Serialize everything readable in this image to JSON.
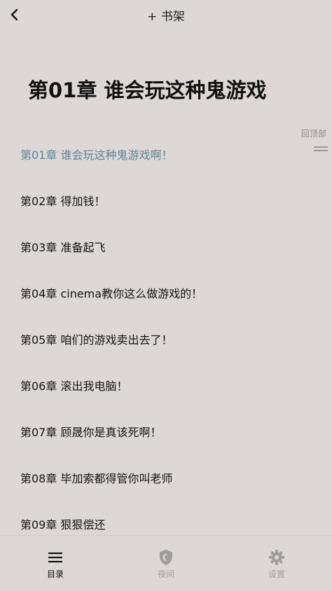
{
  "header": {
    "back_icon": "chevron-left-icon",
    "add_to_shelf": "+ 书架"
  },
  "reader": {
    "chapter_title": "第01章 谁会玩这种鬼游戏啊！",
    "back_to_top": "回顶部"
  },
  "toc": {
    "current_index": 0,
    "items": [
      "第01章 谁会玩这种鬼游戏啊！",
      "第02章 得加钱！",
      "第03章 准备起飞",
      "第04章 cinema教你这么做游戏的！",
      "第05章 咱们的游戏卖出去了！",
      "第06章 滚出我电脑！",
      "第07章 顾晟你是真该死啊！",
      "第08章 毕加索都得管你叫老师",
      "第09章 狠狠偿还"
    ]
  },
  "bottom_nav": {
    "items": [
      {
        "label": "目录",
        "icon": "menu-icon",
        "active": true
      },
      {
        "label": "夜间",
        "icon": "night-shield-icon",
        "active": false
      },
      {
        "label": "设置",
        "icon": "gear-icon",
        "active": false
      }
    ]
  },
  "colors": {
    "background": "#ddd8d5",
    "current_chapter": "#5f8599",
    "inactive": "#a19d9a"
  }
}
